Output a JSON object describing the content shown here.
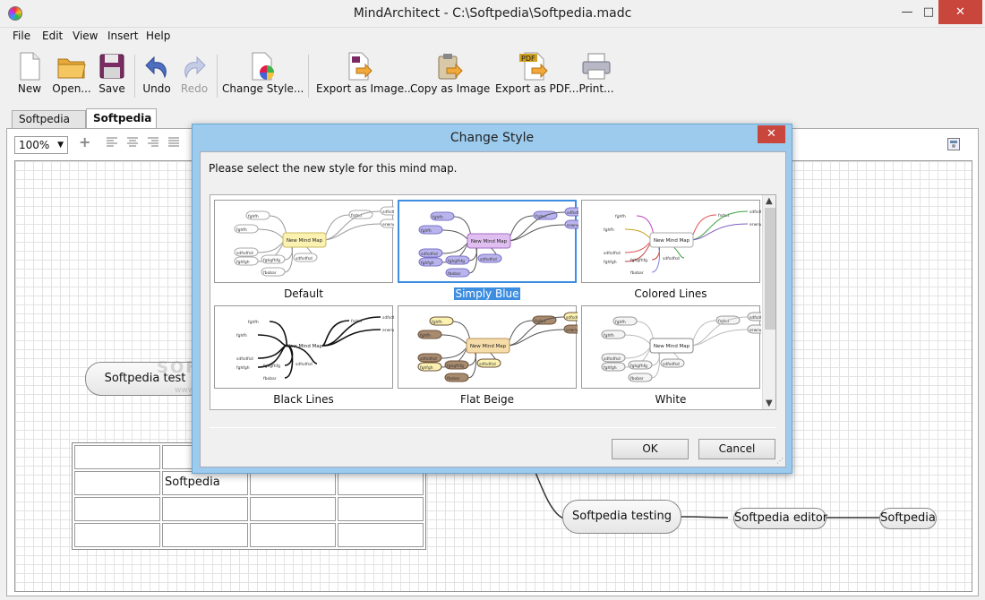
{
  "window": {
    "title": "MindArchitect - C:\\Softpedia\\Softpedia.madc",
    "min": "—",
    "max": "□",
    "close": "✕"
  },
  "menu": [
    "File",
    "Edit",
    "View",
    "Insert",
    "Help"
  ],
  "toolbar": {
    "new": "New",
    "open": "Open...",
    "save": "Save",
    "undo": "Undo",
    "redo": "Redo",
    "change_style": "Change Style...",
    "export_image": "Export as Image...",
    "copy_image": "Copy as Image",
    "export_pdf": "Export as PDF...",
    "print": "Print...",
    "pdf_badge": "PDF"
  },
  "tabs": [
    "Softpedia 1",
    "Softpedia 2"
  ],
  "format": {
    "zoom": "100%",
    "add": "+"
  },
  "canvas": {
    "nodes": {
      "test": "Softpedia test",
      "testing": "Softpedia testing",
      "editor": "Softpedia editor",
      "leaf": "Softpedia"
    },
    "table_cell": "Softpedia",
    "watermark": "SOFTPEDIA",
    "watermark_url": "www.softpedia.com"
  },
  "dialog": {
    "title": "Change Style",
    "close": "✕",
    "prompt": "Please select the new style for this mind map.",
    "styles": [
      "Default",
      "Simply Blue",
      "Colored Lines",
      "Black Lines",
      "Flat Beige",
      "White"
    ],
    "selected": "Simply Blue",
    "ok": "OK",
    "cancel": "Cancel",
    "thumb_center": "New Mind Map",
    "thumb_words": [
      "fghfh",
      "fghfh",
      "fsdsd",
      "sdfsdfsd",
      "erwrwe",
      "sdfsdfsd",
      "fghfgh",
      "fghgfhfg",
      "fbobar",
      "sdfsdfsd"
    ]
  },
  "colors": {
    "accent": "#3d8ee0",
    "dialog_frame": "#9ccbed",
    "close_red": "#c9463d",
    "blue_node": "#b9b4ec",
    "beige_node": "#f5dca8",
    "brown_node": "#a88a6e",
    "yellow_node": "#fbf1b0"
  }
}
